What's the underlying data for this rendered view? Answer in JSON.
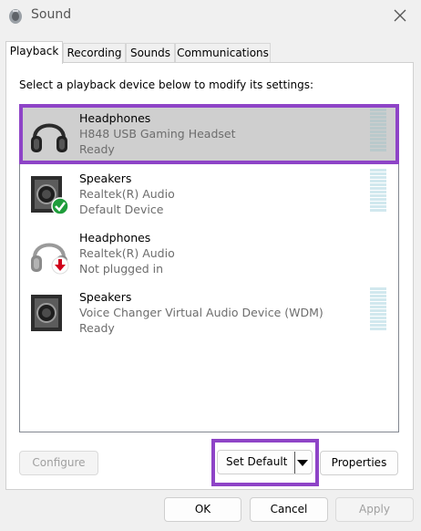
{
  "window": {
    "title": "Sound",
    "icon": "speaker-settings-icon",
    "close_icon": "close-icon"
  },
  "tabs": [
    {
      "label": "Playback",
      "active": true
    },
    {
      "label": "Recording",
      "active": false
    },
    {
      "label": "Sounds",
      "active": false
    },
    {
      "label": "Communications",
      "active": false
    }
  ],
  "instructions": "Select a playback device below to modify its settings:",
  "devices": [
    {
      "name": "Headphones",
      "description": "H848 USB Gaming Headset",
      "status": "Ready",
      "icon": "headphones-icon",
      "badge": null,
      "selected": true
    },
    {
      "name": "Speakers",
      "description": "Realtek(R) Audio",
      "status": "Default Device",
      "icon": "speaker-icon",
      "badge": "green-check-icon",
      "selected": false
    },
    {
      "name": "Headphones",
      "description": "Realtek(R) Audio",
      "status": "Not plugged in",
      "icon": "headphones-icon",
      "badge": "red-down-arrow-icon",
      "selected": false
    },
    {
      "name": "Speakers",
      "description": "Voice Changer Virtual Audio Device (WDM)",
      "status": "Ready",
      "icon": "speaker-icon",
      "badge": null,
      "selected": false
    }
  ],
  "buttons": {
    "configure": "Configure",
    "set_default": "Set Default",
    "properties": "Properties",
    "ok": "OK",
    "cancel": "Cancel",
    "apply": "Apply"
  },
  "colors": {
    "highlight": "#8e44c7",
    "selection": "#cfcfcf"
  }
}
